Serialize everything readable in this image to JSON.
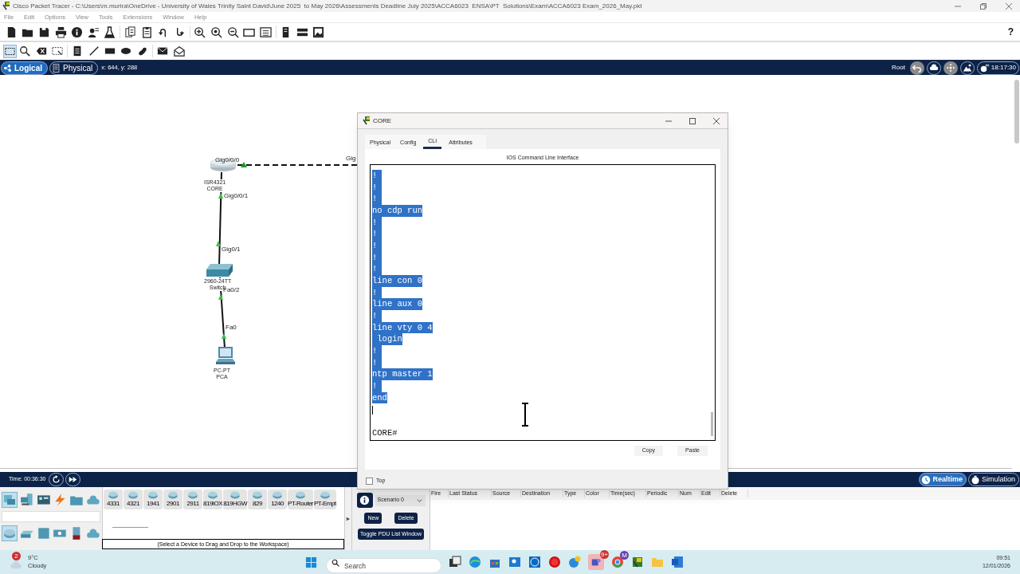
{
  "title_bar": {
    "title": "Cisco Packet Tracer - C:\\Users\\m.murira\\OneDrive - University of Wales Trinity Saint David\\June 2025  to May 2026\\Assessments Deadline July 2025\\ACCA6023  ENSA\\PT  Solutions\\Exam\\ACCA6023 Exam_2026_May.pkt"
  },
  "menu": [
    "File",
    "Edit",
    "Options",
    "View",
    "Tools",
    "Extensions",
    "Window",
    "Help"
  ],
  "help_button": "?",
  "view_bar": {
    "tabs": [
      {
        "label": "Logical",
        "selected": true
      },
      {
        "label": "Physical",
        "selected": false
      }
    ],
    "coordinates": "x: 644, y: 288",
    "root": "Root",
    "clock": "18:17:30"
  },
  "topology": {
    "devices": [
      {
        "kind": "router",
        "model": "ISR4321",
        "name": "CORE"
      },
      {
        "kind": "switch",
        "model": "2960-24TT",
        "name": "Switch"
      },
      {
        "kind": "pc",
        "model": "PC-PT",
        "name": "PCA"
      }
    ],
    "port_labels": [
      "Gig0/0/0",
      "Gig0/0/1",
      "Gig0/1",
      "Fa0/2",
      "Fa0",
      "Gig"
    ]
  },
  "device_window": {
    "title": "CORE",
    "tabs": [
      {
        "label": "Physical",
        "selected": false
      },
      {
        "label": "Config",
        "selected": false
      },
      {
        "label": "CLI",
        "selected": true
      },
      {
        "label": "Attributes",
        "selected": false
      }
    ],
    "heading": "IOS Command Line Interface",
    "lines": [
      {
        "text": "!",
        "selected": true
      },
      {
        "text": "!",
        "selected": true
      },
      {
        "text": "!",
        "selected": true
      },
      {
        "text": "no cdp run",
        "selected": true
      },
      {
        "text": "!",
        "selected": true
      },
      {
        "text": "!",
        "selected": true
      },
      {
        "text": "!",
        "selected": true
      },
      {
        "text": "!",
        "selected": true
      },
      {
        "text": "!",
        "selected": true
      },
      {
        "text": "line con 0",
        "selected": true
      },
      {
        "text": "!",
        "selected": true
      },
      {
        "text": "line aux 0",
        "selected": true
      },
      {
        "text": "!",
        "selected": true
      },
      {
        "text": "line vty 0 4",
        "selected": true
      },
      {
        "text": " login",
        "selected": true
      },
      {
        "text": "!",
        "selected": true
      },
      {
        "text": "!",
        "selected": true
      },
      {
        "text": "ntp master 1",
        "selected": true
      },
      {
        "text": "!",
        "selected": true
      },
      {
        "text": "end",
        "selected": true
      }
    ],
    "prompt": "CORE#",
    "buttons": [
      "Copy",
      "Paste"
    ],
    "top": {
      "label": "Top",
      "checked": false
    }
  },
  "simulation_bar": {
    "time": "Time: 00:36:30",
    "modes": [
      {
        "label": "Realtime",
        "selected": true
      },
      {
        "label": "Simulation",
        "selected": false
      }
    ]
  },
  "device_palette": {
    "models": [
      "4331",
      "4321",
      "1941",
      "2901",
      "2911",
      "819IOX",
      "819HGW",
      "829",
      "1240",
      "PT-Router",
      "PT-Empt"
    ],
    "caption": "(Select a Device to Drag and Drop to the Workspace)"
  },
  "scenario": {
    "name": "Scenario 0",
    "buttons": [
      "New",
      "Delete"
    ],
    "toggle": "Toggle PDU List Window"
  },
  "pdu_table": {
    "columns": [
      "Fire",
      "Last Status",
      "Source",
      "Destination",
      "Type",
      "Color",
      "Time(sec)",
      "Periodic",
      "Num",
      "Edit",
      "Delete"
    ]
  },
  "taskbar": {
    "weather": {
      "temp": "9°C",
      "condition": "Cloudy",
      "badge": "2"
    },
    "search": {
      "placeholder": "Search"
    },
    "teams_badge": "9+",
    "browser_badge": "M",
    "time": "09:51",
    "date": "12/01/2026"
  }
}
